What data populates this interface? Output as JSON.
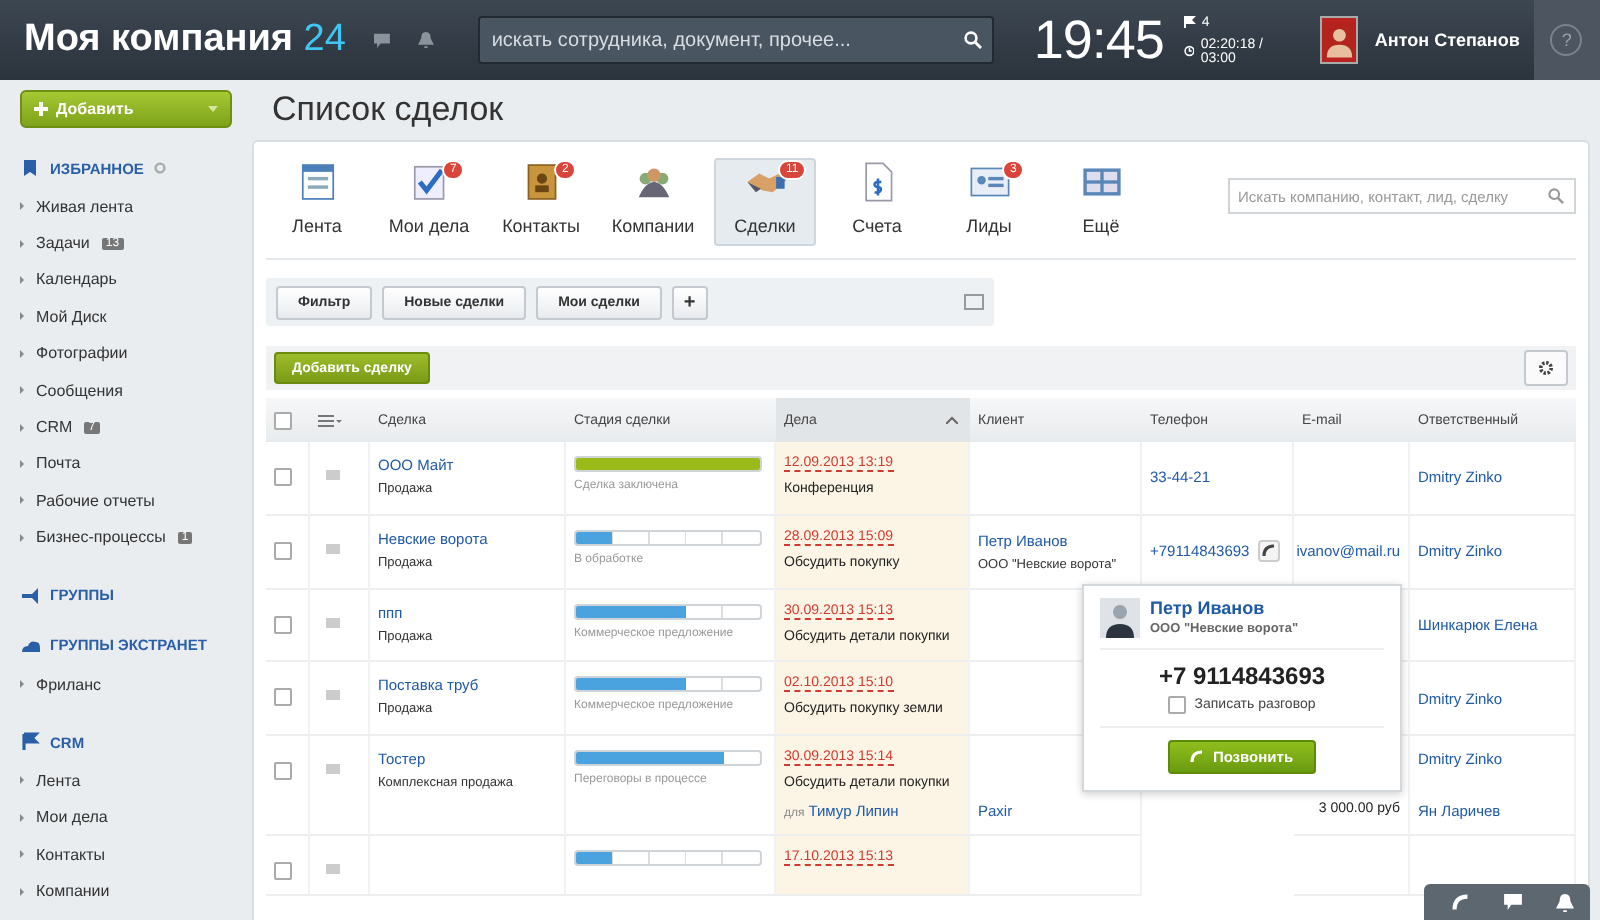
{
  "header": {
    "logo_text": "Моя компания",
    "logo_number": "24",
    "search_placeholder": "искать сотрудника, документ, прочее...",
    "time": "19:45",
    "flag_count": "4",
    "work_timer": "02:20:18 / 03:00",
    "user_name": "Антон Степанов",
    "help": "?"
  },
  "sidebar": {
    "add_button": "Добавить",
    "sections": [
      {
        "title": "ИЗБРАННОЕ",
        "kind": "favorites",
        "items": [
          {
            "label": "Живая лента"
          },
          {
            "label": "Задачи",
            "badge": "13"
          },
          {
            "label": "Календарь"
          },
          {
            "label": "Мой Диск"
          },
          {
            "label": "Фотографии"
          },
          {
            "label": "Сообщения"
          },
          {
            "label": "CRM",
            "badge": "7"
          },
          {
            "label": "Почта"
          },
          {
            "label": "Рабочие отчеты"
          },
          {
            "label": "Бизнес-процессы",
            "badge": "1"
          }
        ]
      },
      {
        "title": "ГРУППЫ",
        "kind": "groups"
      },
      {
        "title": "ГРУППЫ ЭКСТРАНЕТ",
        "kind": "extranet",
        "items": [
          {
            "label": "Фриланс"
          }
        ]
      },
      {
        "title": "CRM",
        "kind": "crm",
        "items": [
          {
            "label": "Лента"
          },
          {
            "label": "Мои дела"
          },
          {
            "label": "Контакты"
          },
          {
            "label": "Компании"
          }
        ]
      }
    ]
  },
  "page_title": "Список сделок",
  "tabs": [
    {
      "label": "Лента",
      "kind": "feed",
      "selected": false
    },
    {
      "label": "Мои дела",
      "kind": "tasks",
      "badge": "7",
      "selected": false
    },
    {
      "label": "Контакты",
      "kind": "contacts",
      "badge": "2",
      "selected": false
    },
    {
      "label": "Компании",
      "kind": "companies",
      "selected": false
    },
    {
      "label": "Сделки",
      "kind": "deals",
      "badge": "11",
      "selected": true
    },
    {
      "label": "Счета",
      "kind": "invoices",
      "selected": false
    },
    {
      "label": "Лиды",
      "kind": "leads",
      "badge": "3",
      "selected": false
    },
    {
      "label": "Ещё",
      "kind": "more",
      "selected": false
    }
  ],
  "crm_search": {
    "placeholder": "Искать компанию, контакт, лид, сделку"
  },
  "filters": [
    "Фильтр",
    "Новые сделки",
    "Мои сделки"
  ],
  "add_filter": "+",
  "add_deal_button": "Добавить сделку",
  "table": {
    "all_checked": false,
    "columns": [
      {
        "label": "Сделка",
        "sorted": false
      },
      {
        "label": "Стадия сделки",
        "sorted": false
      },
      {
        "label": "Дела",
        "sorted": true
      },
      {
        "label": "Клиент",
        "sorted": false
      },
      {
        "label": "Телефон",
        "sorted": false
      },
      {
        "label": "E-mail",
        "sorted": false
      },
      {
        "label": "Ответственный",
        "sorted": false
      }
    ],
    "rows": [
      {
        "checked": false,
        "title": "ООО Майт",
        "type": "Продажа",
        "stage": {
          "level": 1,
          "color": "#9bbb1b",
          "label": "Сделка заключена"
        },
        "activity": {
          "date": "12.09.2013 13:19",
          "text": "Конференция"
        },
        "phone": "33-44-21",
        "responsible": "Dmitry Zinko"
      },
      {
        "checked": false,
        "title": "Невские ворота",
        "type": "Продажа",
        "stage": {
          "level": 0.2,
          "color": "#4aa3df",
          "label": "В обработке"
        },
        "activity": {
          "date": "28.09.2013 15:09",
          "text": "Обсудить покупку"
        },
        "client": "Петр Иванов",
        "client_company": "ООО \"Невские ворота\"",
        "phone": "+79114843693",
        "email": "ivanov@mail.ru",
        "responsible": "Dmitry Zinko"
      },
      {
        "checked": false,
        "title": "ппп",
        "type": "Продажа",
        "stage": {
          "level": 0.6,
          "color": "#4aa3df",
          "label": "Коммерческое предложение"
        },
        "activity": {
          "date": "30.09.2013 15:13",
          "text": "Обсудить детали покупки"
        },
        "responsible": "Шинкарюк Елена"
      },
      {
        "checked": false,
        "title": "Поставка труб",
        "type": "Продажа",
        "stage": {
          "level": 0.6,
          "color": "#4aa3df",
          "label": "Коммерческое предложение"
        },
        "activity": {
          "date": "02.10.2013 15:10",
          "text": "Обсудить покупку земли"
        },
        "responsible": "Dmitry Zinko"
      },
      {
        "checked": false,
        "title": "Тостер",
        "type": "Комплексная продажа",
        "stage": {
          "level": 0.8,
          "color": "#4aa3df",
          "label": "Переговоры в процессе"
        },
        "activity": {
          "date": "30.09.2013 15:14",
          "text": "Обсудить детали покупки",
          "for_label": "для",
          "for_person": "Тимур Липин"
        },
        "client": "Paxir",
        "amount": "3 000.00 руб",
        "responsible": "Dmitry Zinko",
        "responsible_2": "Ян Ларичев"
      },
      {
        "checked": false,
        "stage": {
          "level": 0.2,
          "color": "#4aa3df"
        },
        "activity": {
          "date": "17.10.2013 15:13"
        }
      }
    ]
  },
  "call_popup": {
    "name": "Петр Иванов",
    "company": "ООО \"Невские ворота\"",
    "phone": "+7 9114843693",
    "record_label": "Записать разговор",
    "record_checked": false,
    "call_button": "Позвонить"
  }
}
